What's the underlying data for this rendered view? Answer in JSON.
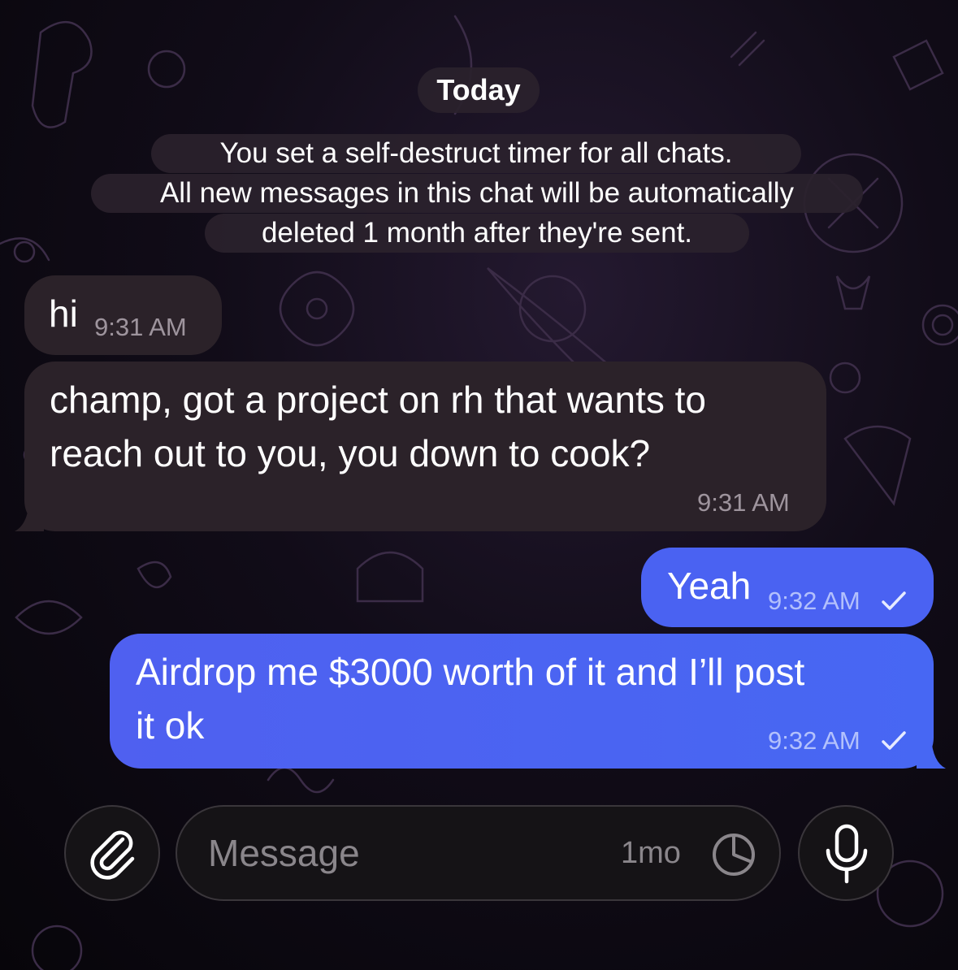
{
  "chat": {
    "date_separator": "Today",
    "service_message": {
      "line1": "You set a self-destruct timer for all chats.",
      "line2": "All new messages in this chat will be automatically",
      "line3": "deleted 1 month after they're sent."
    },
    "messages": [
      {
        "direction": "incoming",
        "text": "hi",
        "time": "9:31 AM"
      },
      {
        "direction": "incoming",
        "text_line1": "champ, got a project on rh that wants to",
        "text_line2": "reach out to you, you down to cook?",
        "time": "9:31 AM"
      },
      {
        "direction": "outgoing",
        "text": "Yeah",
        "time": "9:32 AM",
        "status": "check-icon"
      },
      {
        "direction": "outgoing",
        "text_line1": "Airdrop me $3000 worth of it and I’ll post",
        "text_line2": "it ok",
        "time": "9:32 AM",
        "status": "check-icon"
      }
    ]
  },
  "composer": {
    "attach_icon": "paperclip-icon",
    "placeholder": "Message",
    "timer_label": "1mo",
    "timer_icon": "timer-clock-icon",
    "mic_icon": "microphone-icon"
  },
  "colors": {
    "incoming_bubble": "#2b2229",
    "outgoing_bubble": "#4a62f2",
    "background": "#000000"
  }
}
